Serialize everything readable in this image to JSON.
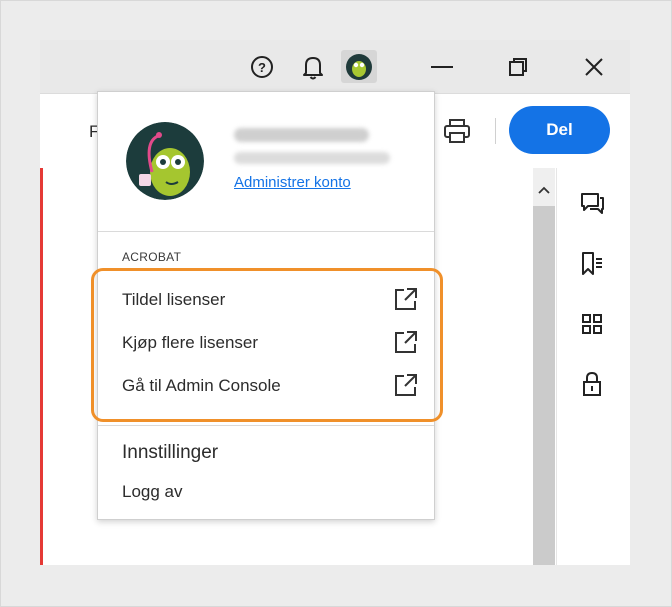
{
  "toolbar": {
    "clipped_label": "F",
    "share_label": "Del"
  },
  "account_menu": {
    "manage_link": "Administrer konto",
    "section_label": "ACROBAT",
    "items": [
      {
        "label": "Tildel lisenser",
        "icon": "external-link-icon"
      },
      {
        "label": "Kjøp flere lisenser",
        "icon": "external-link-icon"
      },
      {
        "label": "Gå til Admin Console",
        "icon": "external-link-icon"
      }
    ],
    "settings_label": "Innstillinger",
    "logout_label": "Logg av"
  },
  "colors": {
    "accent": "#1473e6",
    "highlight": "#f0902a",
    "doc_edge": "#e53935"
  },
  "icons": [
    "help-icon",
    "bell-icon",
    "avatar",
    "minimize-icon",
    "maximize-icon",
    "close-icon",
    "print-icon",
    "comment-icon",
    "bookmark-icon",
    "grid-icon",
    "lock-icon",
    "chevron-up-icon"
  ]
}
